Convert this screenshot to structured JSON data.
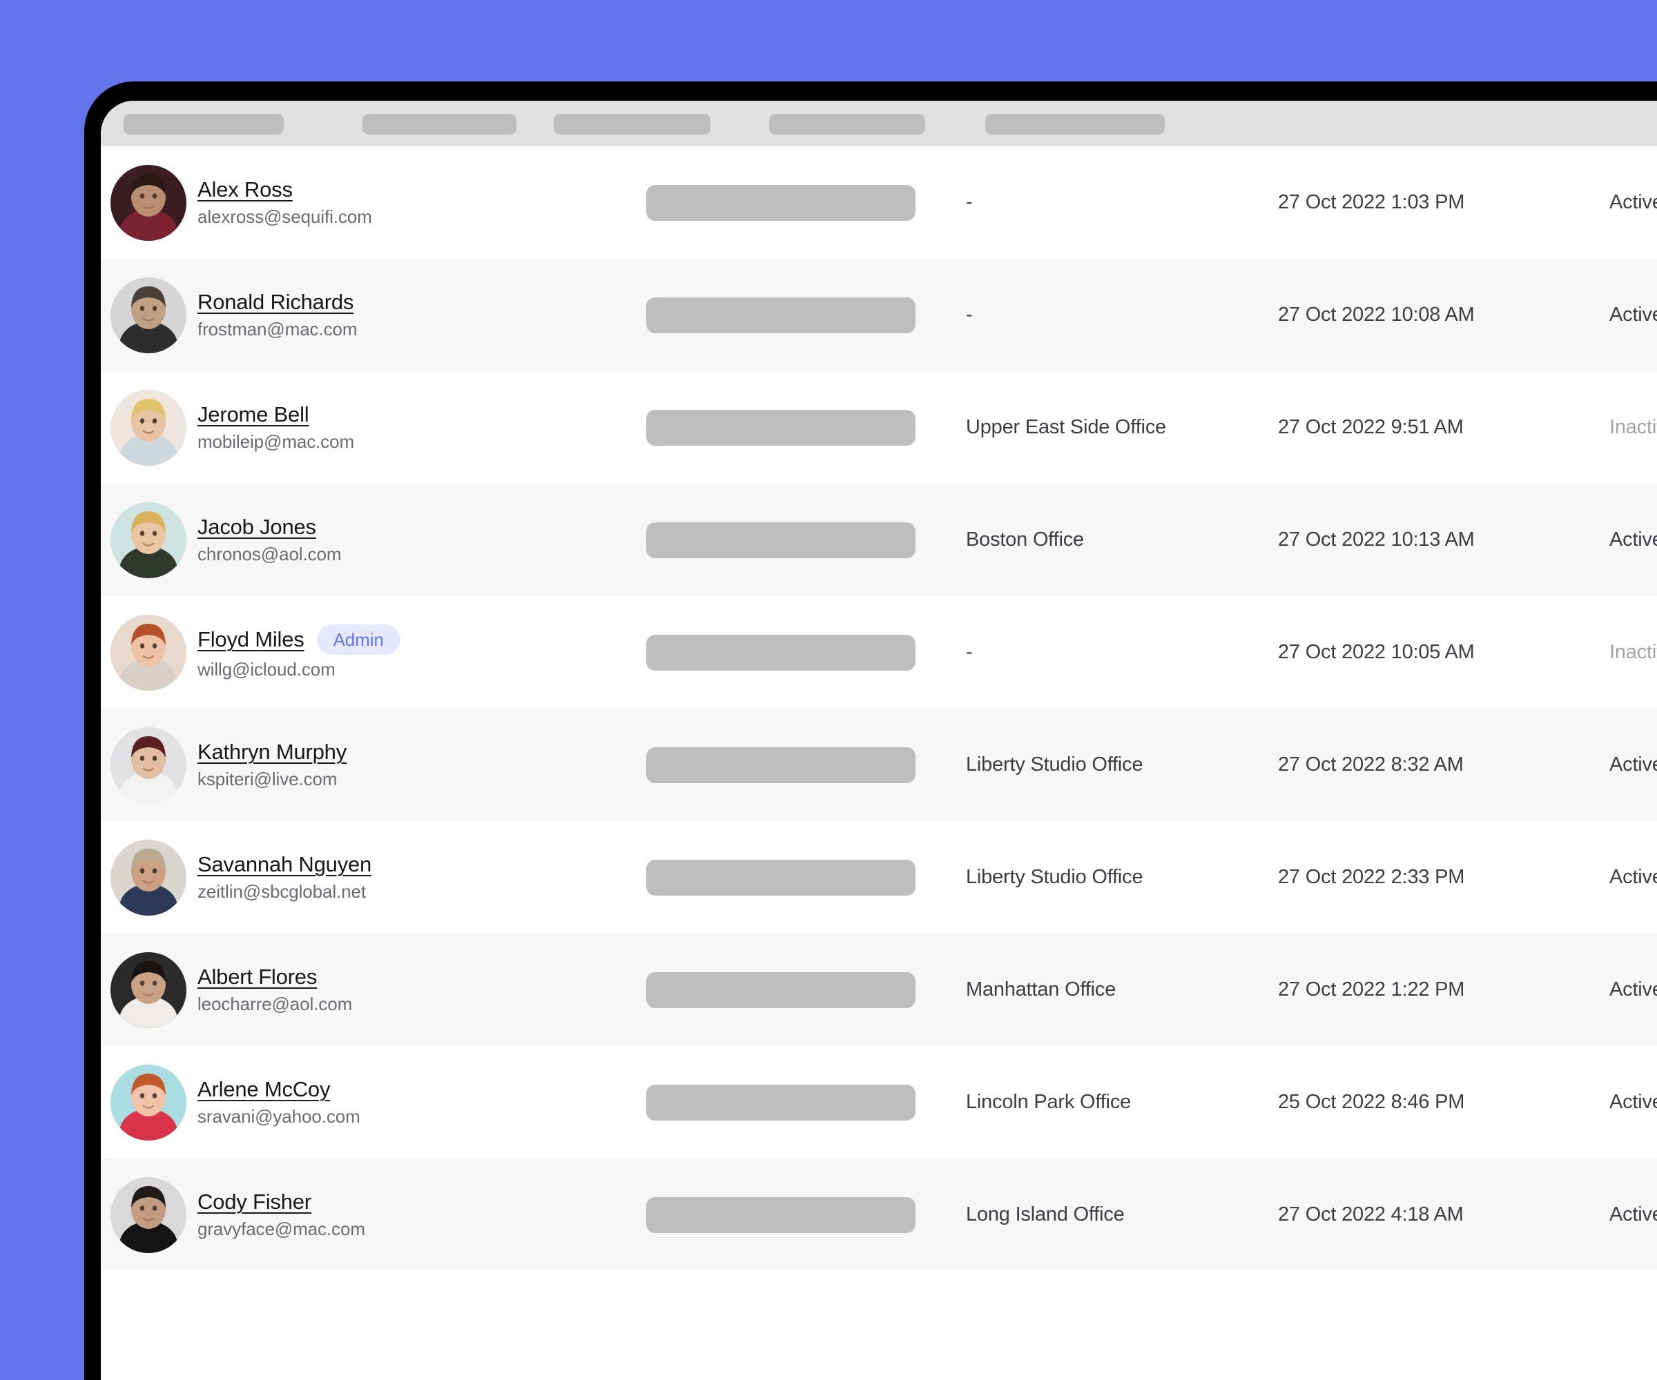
{
  "theme": {
    "backdrop_color": "#6375EB",
    "bezel_color": "#000000",
    "screen_color": "#FFFFFF",
    "header_bg_color": "#E1E1E1",
    "skeleton_color": "#BEBEBE",
    "row_alt_color": "#F7F7F7",
    "badge_bg_color": "#E6E9FD",
    "badge_text_color": "#6375EB",
    "text_color": "#3D3D44",
    "muted_text_color": "#A3A3AA"
  },
  "table": {
    "header": {
      "placeholders": [
        {
          "name": "column-header-placeholder-1"
        },
        {
          "name": "column-header-placeholder-2"
        },
        {
          "name": "column-header-placeholder-3"
        },
        {
          "name": "column-header-placeholder-4"
        },
        {
          "name": "column-header-placeholder-5"
        }
      ]
    },
    "rows": [
      {
        "name": "Alex Ross",
        "email": "alexross@sequifi.com",
        "badge": null,
        "office": "-",
        "date": "27 Oct 2022 1:03 PM",
        "status": "Active"
      },
      {
        "name": "Ronald Richards",
        "email": "frostman@mac.com",
        "badge": null,
        "office": "-",
        "date": "27 Oct 2022 10:08 AM",
        "status": "Active"
      },
      {
        "name": "Jerome Bell",
        "email": "mobileip@mac.com",
        "badge": null,
        "office": "Upper East Side Office",
        "date": "27 Oct 2022 9:51 AM",
        "status": "Inactive"
      },
      {
        "name": "Jacob Jones",
        "email": "chronos@aol.com",
        "badge": null,
        "office": "Boston Office",
        "date": "27 Oct 2022 10:13 AM",
        "status": "Active"
      },
      {
        "name": "Floyd Miles",
        "email": "willg@icloud.com",
        "badge": "Admin",
        "office": "-",
        "date": "27 Oct 2022 10:05 AM",
        "status": "Inactive"
      },
      {
        "name": "Kathryn Murphy",
        "email": "kspiteri@live.com",
        "badge": null,
        "office": "Liberty Studio Office",
        "date": "27 Oct 2022 8:32 AM",
        "status": "Active"
      },
      {
        "name": "Savannah Nguyen",
        "email": "zeitlin@sbcglobal.net",
        "badge": null,
        "office": "Liberty Studio Office",
        "date": "27 Oct 2022 2:33 PM",
        "status": "Active"
      },
      {
        "name": "Albert Flores",
        "email": "leocharre@aol.com",
        "badge": null,
        "office": "Manhattan Office",
        "date": "27 Oct 2022 1:22 PM",
        "status": "Active"
      },
      {
        "name": "Arlene McCoy",
        "email": "sravani@yahoo.com",
        "badge": null,
        "office": "Lincoln Park Office",
        "date": "25 Oct 2022 8:46 PM",
        "status": "Active"
      },
      {
        "name": "Cody Fisher",
        "email": "gravyface@mac.com",
        "badge": null,
        "office": "Long Island Office",
        "date": "27 Oct 2022 4:18 AM",
        "status": "Active"
      }
    ]
  }
}
